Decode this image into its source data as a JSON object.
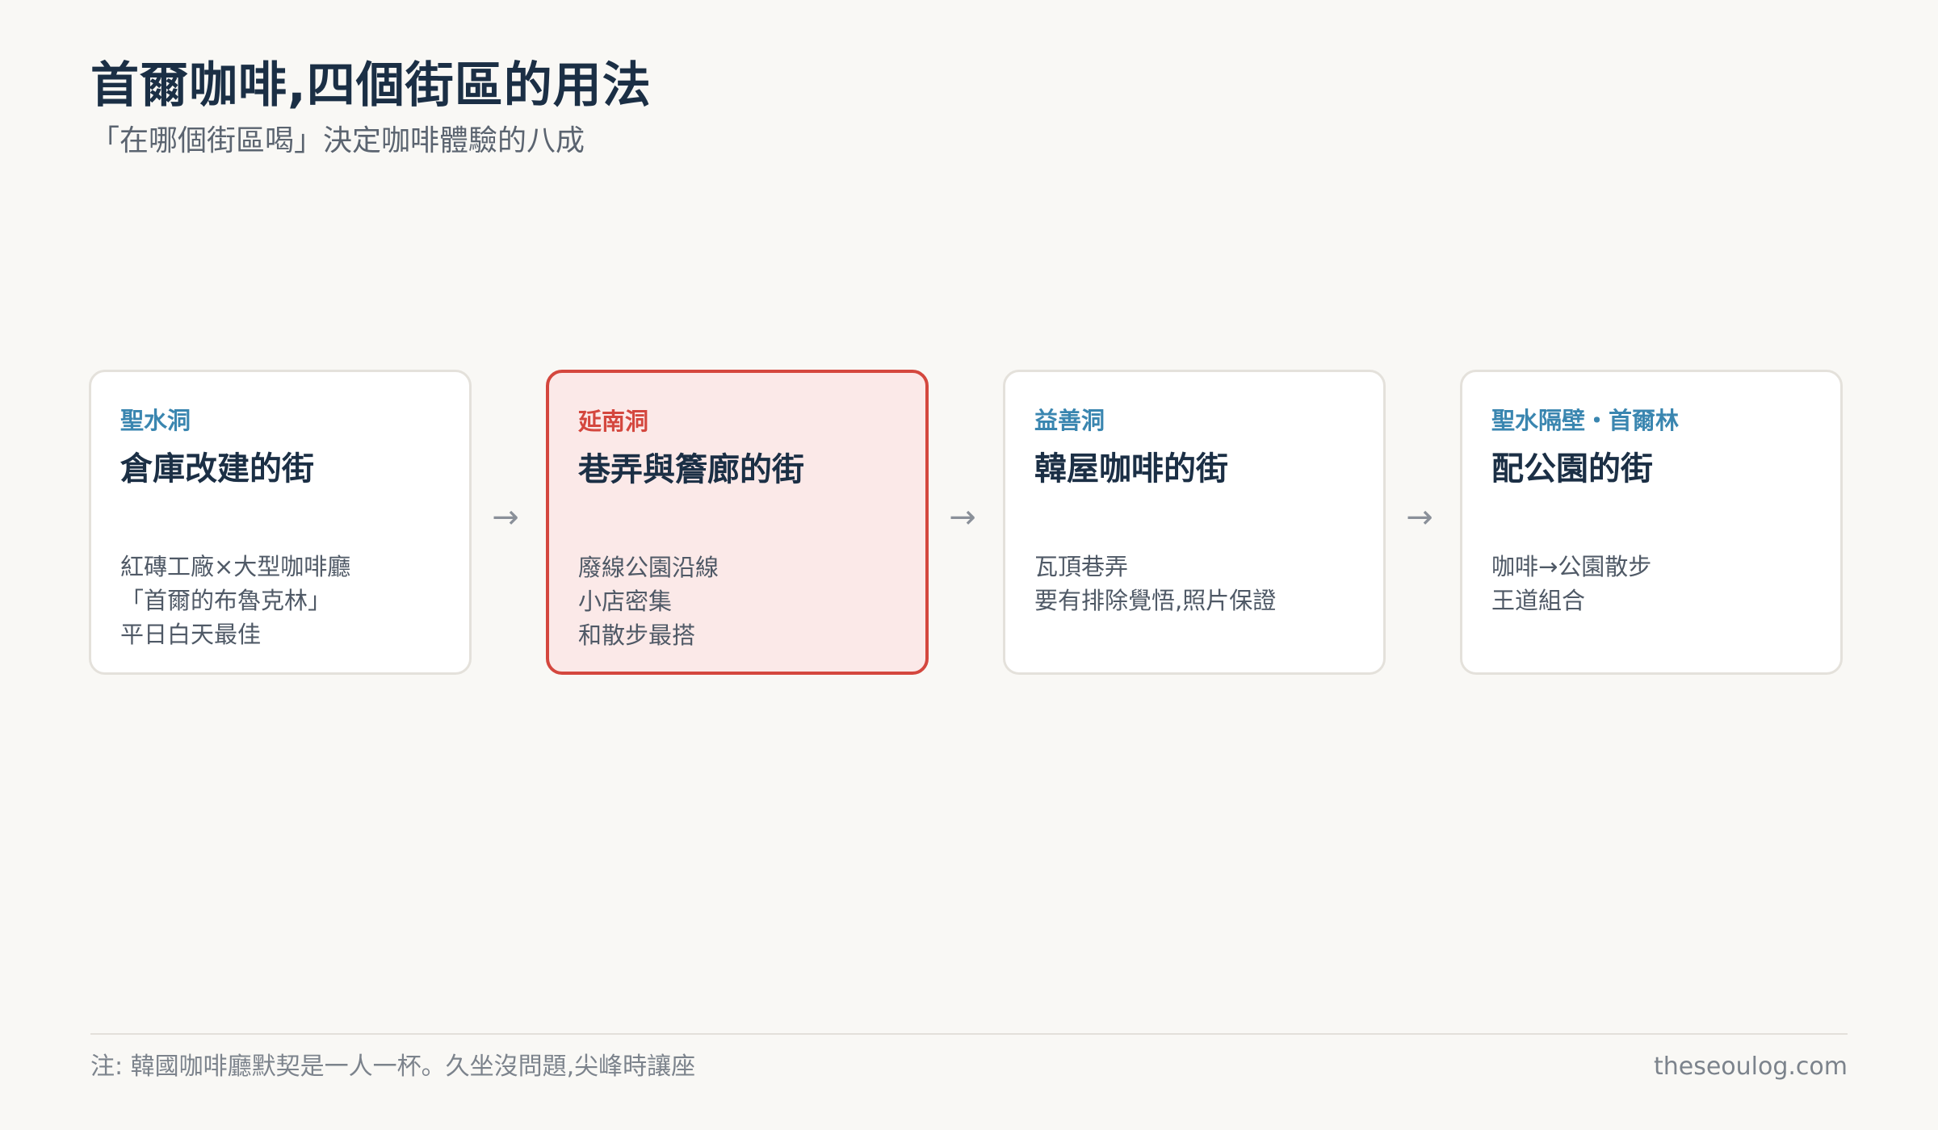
{
  "header": {
    "title": "首爾咖啡,四個街區的用法",
    "subtitle": "「在哪個街區喝」決定咖啡體驗的八成"
  },
  "cards": [
    {
      "district": "聖水洞",
      "concept": "倉庫改建的街",
      "details": [
        "紅磚工廠×大型咖啡廳",
        "「首爾的布魯克林」",
        "平日白天最佳"
      ]
    },
    {
      "district": "延南洞",
      "concept": "巷弄與簷廊的街",
      "details": [
        "廢線公園沿線",
        "小店密集",
        "和散步最搭"
      ]
    },
    {
      "district": "益善洞",
      "concept": "韓屋咖啡的街",
      "details": [
        "瓦頂巷弄",
        "要有排除覺悟,照片保證"
      ]
    },
    {
      "district": "聖水隔壁・首爾林",
      "concept": "配公園的街",
      "details": [
        "咖啡→公園散步",
        "王道組合"
      ]
    }
  ],
  "arrows": [
    "→",
    "→",
    "→"
  ],
  "footer": {
    "note": "注: 韓國咖啡廳默契是一人一杯。久坐沒問題,尖峰時讓座",
    "site": "theseoulog.com"
  },
  "colors": {
    "background": "#f9f8f5",
    "title": "#1b2f45",
    "accent_blue": "#3a86b0",
    "highlight_red": "#d4473e",
    "highlight_fill": "#fbe9e8"
  }
}
